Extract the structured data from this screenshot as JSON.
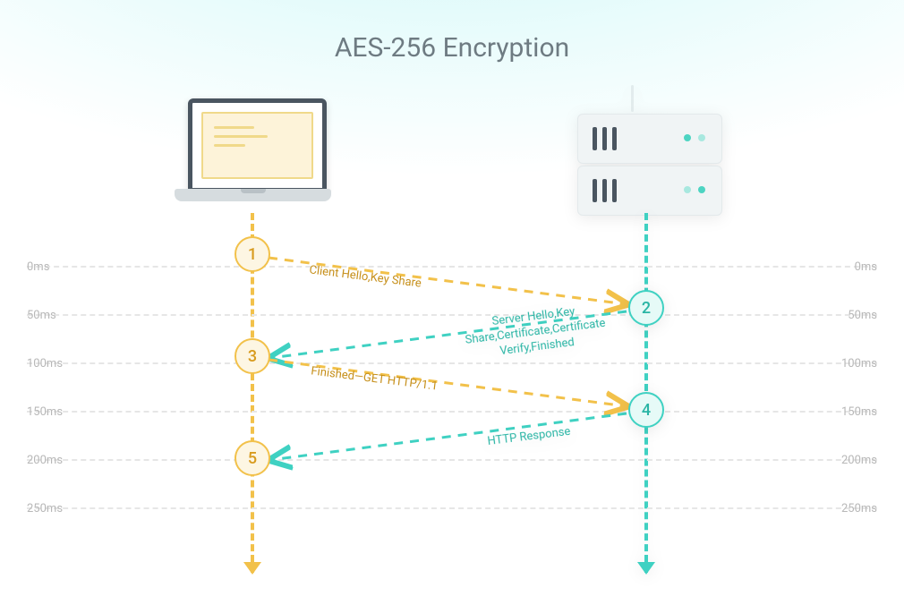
{
  "title": "AES-256 Encryption",
  "colors": {
    "client": "#f2c14a",
    "server": "#3fd1c2",
    "title": "#6e7b82",
    "tick": "#b8b8b8"
  },
  "ticks": [
    "0ms",
    "50ms",
    "100ms",
    "150ms",
    "200ms",
    "250ms"
  ],
  "nodes": {
    "1": "1",
    "2": "2",
    "3": "3",
    "4": "4",
    "5": "5"
  },
  "messages": {
    "m1": "Client Hello,Key Share",
    "m2": "Server Hello,Key Share,Certificate,Certificate Verify,Finished",
    "m3": "Finished—GET HTTP/1.1",
    "m4": "HTTP Response"
  },
  "devices": {
    "client": "laptop",
    "server": "server"
  }
}
